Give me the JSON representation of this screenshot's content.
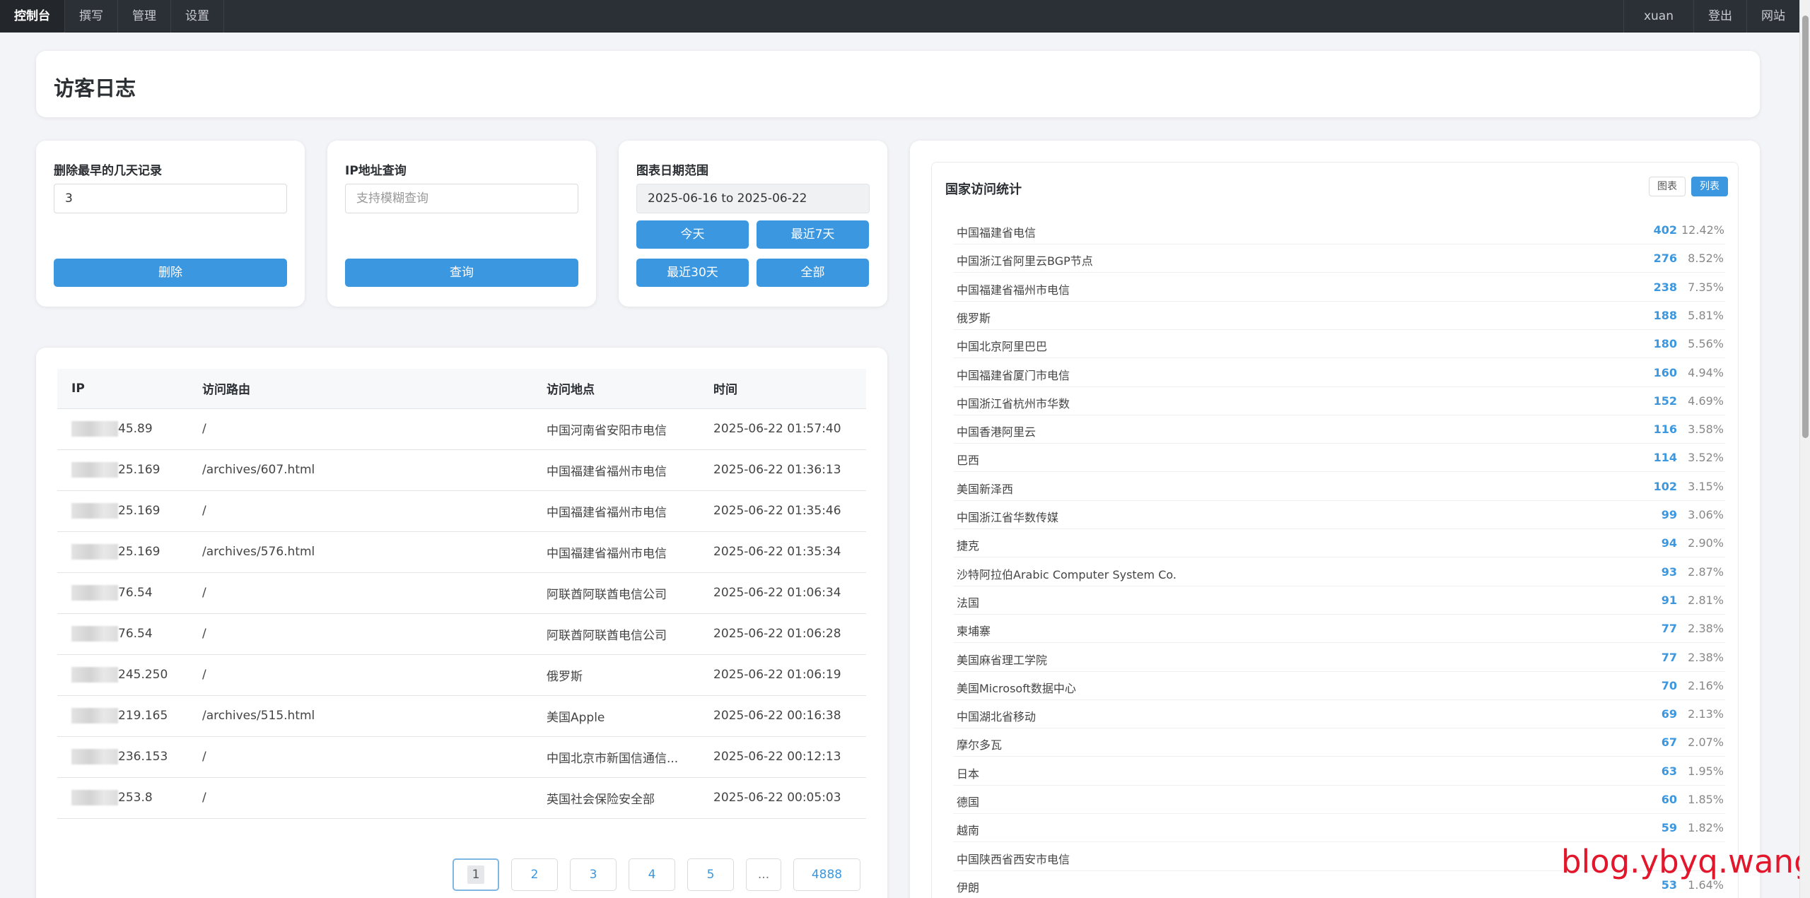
{
  "nav": {
    "left": [
      "控制台",
      "撰写",
      "管理",
      "设置"
    ],
    "right": [
      "xuan",
      "登出",
      "网站"
    ]
  },
  "page_title": "访客日志",
  "delete_tool": {
    "title": "删除最早的几天记录",
    "value": "3",
    "button": "删除"
  },
  "ip_tool": {
    "title": "IP地址查询",
    "placeholder": "支持模糊查询",
    "button": "查询"
  },
  "date_tool": {
    "title": "图表日期范围",
    "range": "2025-06-16 to 2025-06-22",
    "buttons": [
      "今天",
      "最近7天",
      "最近30天",
      "全部"
    ]
  },
  "log_table": {
    "headers": [
      "IP",
      "访问路由",
      "访问地点",
      "时间"
    ],
    "rows": [
      {
        "ip": "45.89",
        "route": "/",
        "location": "中国河南省安阳市电信",
        "time": "2025-06-22 01:57:40"
      },
      {
        "ip": "25.169",
        "route": "/archives/607.html",
        "location": "中国福建省福州市电信",
        "time": "2025-06-22 01:36:13"
      },
      {
        "ip": "25.169",
        "route": "/",
        "location": "中国福建省福州市电信",
        "time": "2025-06-22 01:35:46"
      },
      {
        "ip": "25.169",
        "route": "/archives/576.html",
        "location": "中国福建省福州市电信",
        "time": "2025-06-22 01:35:34"
      },
      {
        "ip": "76.54",
        "route": "/",
        "location": "阿联酋阿联酋电信公司",
        "time": "2025-06-22 01:06:34"
      },
      {
        "ip": "76.54",
        "route": "/",
        "location": "阿联酋阿联酋电信公司",
        "time": "2025-06-22 01:06:28"
      },
      {
        "ip": "245.250",
        "route": "/",
        "location": "俄罗斯",
        "time": "2025-06-22 01:06:19"
      },
      {
        "ip": "219.165",
        "route": "/archives/515.html",
        "location": "美国Apple",
        "time": "2025-06-22 00:16:38"
      },
      {
        "ip": "236.153",
        "route": "/",
        "location": "中国北京市新国信通信...",
        "time": "2025-06-22 00:12:13"
      },
      {
        "ip": "253.8",
        "route": "/",
        "location": "英国社会保险安全部",
        "time": "2025-06-22 00:05:03"
      }
    ]
  },
  "pagination": [
    "1",
    "2",
    "3",
    "4",
    "5",
    "...",
    "4888"
  ],
  "country_stats": {
    "title": "国家访问统计",
    "toggle_chart": "图表",
    "toggle_list": "列表",
    "rows": [
      {
        "name": "中国福建省电信",
        "count": "402",
        "pct": "12.42%"
      },
      {
        "name": "中国浙江省阿里云BGP节点",
        "count": "276",
        "pct": "8.52%"
      },
      {
        "name": "中国福建省福州市电信",
        "count": "238",
        "pct": "7.35%"
      },
      {
        "name": "俄罗斯",
        "count": "188",
        "pct": "5.81%"
      },
      {
        "name": "中国北京阿里巴巴",
        "count": "180",
        "pct": "5.56%"
      },
      {
        "name": "中国福建省厦门市电信",
        "count": "160",
        "pct": "4.94%"
      },
      {
        "name": "中国浙江省杭州市华数",
        "count": "152",
        "pct": "4.69%"
      },
      {
        "name": "中国香港阿里云",
        "count": "116",
        "pct": "3.58%"
      },
      {
        "name": "巴西",
        "count": "114",
        "pct": "3.52%"
      },
      {
        "name": "美国新泽西",
        "count": "102",
        "pct": "3.15%"
      },
      {
        "name": "中国浙江省华数传媒",
        "count": "99",
        "pct": "3.06%"
      },
      {
        "name": "捷克",
        "count": "94",
        "pct": "2.90%"
      },
      {
        "name": "沙特阿拉伯Arabic Computer System Co.",
        "count": "93",
        "pct": "2.87%"
      },
      {
        "name": "法国",
        "count": "91",
        "pct": "2.81%"
      },
      {
        "name": "柬埔寨",
        "count": "77",
        "pct": "2.38%"
      },
      {
        "name": "美国麻省理工学院",
        "count": "77",
        "pct": "2.38%"
      },
      {
        "name": "美国Microsoft数据中心",
        "count": "70",
        "pct": "2.16%"
      },
      {
        "name": "中国湖北省移动",
        "count": "69",
        "pct": "2.13%"
      },
      {
        "name": "摩尔多瓦",
        "count": "67",
        "pct": "2.07%"
      },
      {
        "name": "日本",
        "count": "63",
        "pct": "1.95%"
      },
      {
        "name": "德国",
        "count": "60",
        "pct": "1.85%"
      },
      {
        "name": "越南",
        "count": "59",
        "pct": "1.82%"
      },
      {
        "name": "中国陕西省西安市电信",
        "count": "",
        "pct": ""
      },
      {
        "name": "伊朗",
        "count": "53",
        "pct": "1.64%"
      }
    ]
  },
  "watermark": "blog.ybyq.wang",
  "colors": {
    "accent": "#3b97df",
    "nav_bg": "#2b3036",
    "watermark": "#e3172b"
  }
}
